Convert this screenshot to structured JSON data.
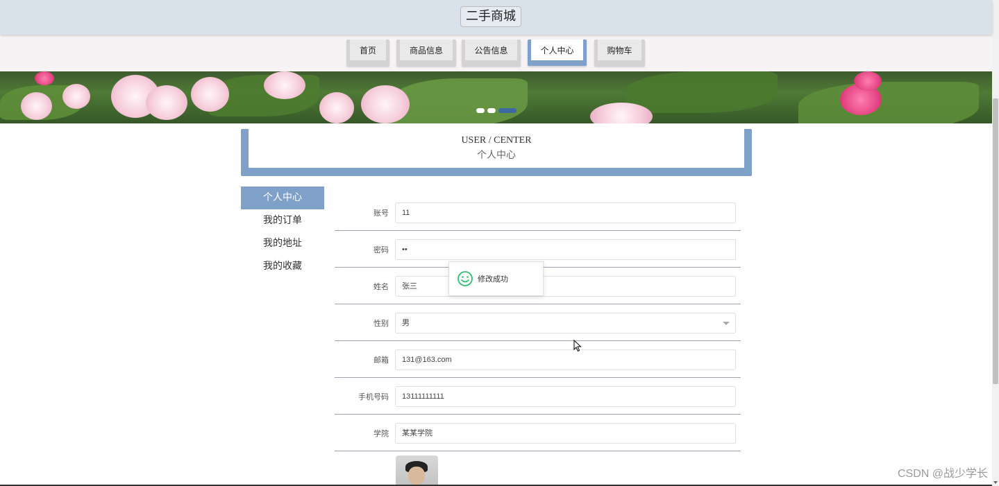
{
  "header": {
    "site_title": "二手商城"
  },
  "nav": {
    "tabs": [
      {
        "label": "首页",
        "active": false
      },
      {
        "label": "商品信息",
        "active": false
      },
      {
        "label": "公告信息",
        "active": false
      },
      {
        "label": "个人中心",
        "active": true
      },
      {
        "label": "购物车",
        "active": false
      }
    ]
  },
  "banner": {
    "slide_count": 3,
    "active_slide": 3
  },
  "section_title": {
    "en": "USER / CENTER",
    "cn": "个人中心"
  },
  "side_menu": {
    "items": [
      {
        "label": "个人中心",
        "active": true
      },
      {
        "label": "我的订单",
        "active": false
      },
      {
        "label": "我的地址",
        "active": false
      },
      {
        "label": "我的收藏",
        "active": false
      }
    ]
  },
  "form": {
    "account": {
      "label": "账号",
      "value": "11"
    },
    "password": {
      "label": "密码",
      "value": "••"
    },
    "name": {
      "label": "姓名",
      "value": "张三"
    },
    "gender": {
      "label": "性别",
      "value": "男"
    },
    "email": {
      "label": "邮箱",
      "value": "131@163.com"
    },
    "phone": {
      "label": "手机号码",
      "value": "13111111111"
    },
    "college": {
      "label": "学院",
      "value": "某某学院"
    }
  },
  "toast": {
    "message": "修改成功"
  },
  "watermark": "CSDN @战少学长",
  "colors": {
    "accent": "#7fa0c8",
    "header_bg": "#d9e1ea",
    "active_dot": "#3d6aa3",
    "toast_icon": "#2fbf71"
  }
}
